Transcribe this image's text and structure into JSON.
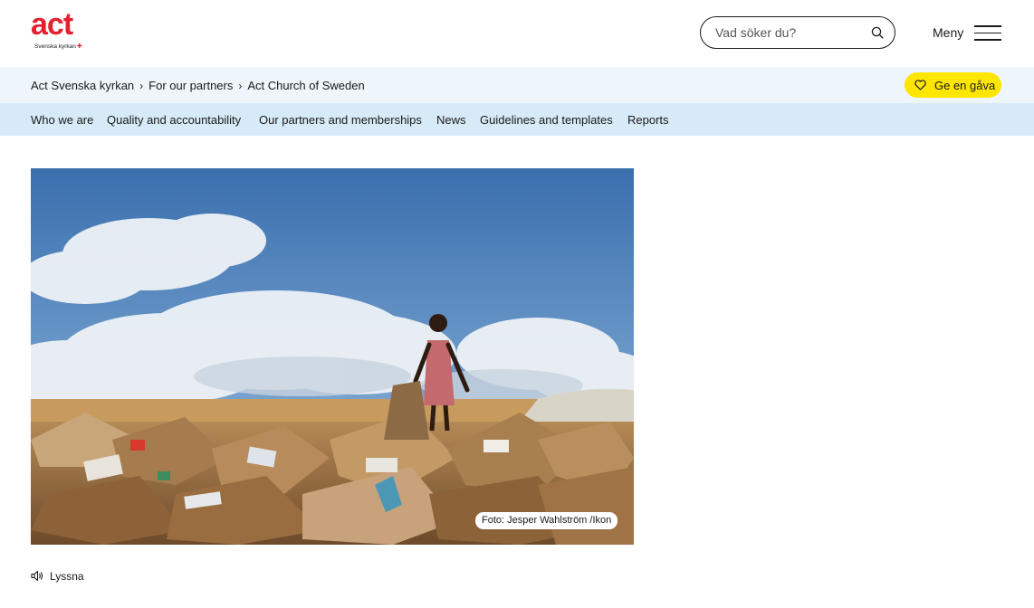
{
  "header": {
    "logo_text": "act",
    "logo_subtext": "Svenska kyrkan",
    "search": {
      "placeholder": "Vad söker du?"
    },
    "menu_label": "Meny"
  },
  "breadcrumb": {
    "items": [
      {
        "label": "Act Svenska kyrkan"
      },
      {
        "label": "For our partners"
      },
      {
        "label": "Act Church of Sweden"
      }
    ],
    "separator": "›"
  },
  "donate_button": {
    "label": "Ge en gåva",
    "color": "#ffe600"
  },
  "subnav": {
    "items": [
      {
        "label": "Who we are"
      },
      {
        "label": "Quality and accountability"
      },
      {
        "label": "Our partners and memberships"
      },
      {
        "label": "News"
      },
      {
        "label": "Guidelines and templates"
      },
      {
        "label": "Reports"
      }
    ]
  },
  "hero": {
    "photo_credit": "Foto: Jesper Wahlström /Ikon"
  },
  "listen": {
    "label": "Lyssna"
  },
  "colors": {
    "brand_red": "#e5202e",
    "crumb_bg": "#eef5fb",
    "subnav_bg": "#d7eaf7",
    "accent_yellow": "#ffe600"
  }
}
